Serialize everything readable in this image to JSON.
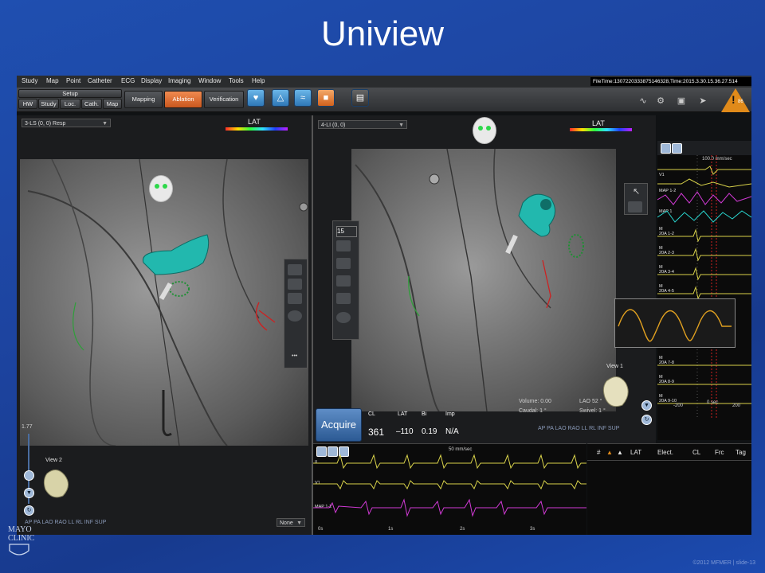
{
  "slide": {
    "title": "Uniview"
  },
  "menu": [
    "Study",
    "Map",
    "Point",
    "Catheter",
    "ECG",
    "Display",
    "Imaging",
    "Window",
    "Tools",
    "Help"
  ],
  "file_time": "FileTime:1307220333875146328,Time:2015.3.30.15.36.27.514",
  "toolbar": {
    "setup_label": "Setup",
    "setup_tabs": [
      "HW",
      "Study",
      "Loc.",
      "Cath.",
      "Map"
    ],
    "mode_buttons": [
      "Mapping",
      "Ablation",
      "Verification"
    ],
    "active_mode": "Ablation",
    "warning_count": "86"
  },
  "left_view": {
    "dropdown": "3-LS (0, 0) Resp",
    "lat_label": "LAT",
    "zoom_value": "1.77",
    "view_label": "View 2",
    "projections": "AP  PA  LAO  RAO  LL  RL  INF  SUP",
    "none_dropdown": "None"
  },
  "mid_view": {
    "dropdown": "4-LI (0, 0)",
    "lat_label": "LAT",
    "view_label": "View 1",
    "volume_text": "Volume: 0.00",
    "lao_text": "LAO    52 °",
    "caudal_text": "Caudal:    1 °",
    "swivel_text": "Swivel:    1 °",
    "projections": "AP  PA  LAO  RAO  LL  RL  INF  SUP",
    "tool_value": "15",
    "acquire_label": "Acquire",
    "readout": {
      "headers": [
        "CL",
        "LAT",
        "Bi",
        "Imp"
      ],
      "values": [
        "361",
        "–110",
        "0.19",
        "N/A"
      ]
    }
  },
  "right_ecg": {
    "speed": "100.0 mm/sec",
    "channels": [
      "V1",
      "MAP 1-2",
      "MAP 1",
      "M",
      "20A 1-2",
      "M",
      "20A 2-3",
      "M",
      "20A 3-4",
      "M",
      "20A 4-5",
      "M",
      "20A 7-8",
      "M",
      "20A 8-9",
      "M",
      "20A 9-10"
    ],
    "axis": [
      "-200",
      "0 sec",
      "200"
    ]
  },
  "bottom_ecg": {
    "speed": "50 mm/sec",
    "channels": [
      "II",
      "V1",
      "MAP 1-2"
    ],
    "axis": [
      "0s",
      "1s",
      "2s",
      "3s"
    ]
  },
  "lat_table": {
    "headers": [
      "#",
      "LAT",
      "Elect.",
      "CL",
      "Frc",
      "Tag"
    ]
  },
  "branding": {
    "logo_text": "MAYO CLINIC",
    "footer": "©2012 MFMER  |  slide-13"
  },
  "colors": {
    "accent_orange": "#d3621c",
    "slide_blue": "#1d44a0",
    "ecg_yellow": "#d8d24a",
    "ecg_magenta": "#d23ad6",
    "ecg_cyan": "#2ad7d0"
  }
}
